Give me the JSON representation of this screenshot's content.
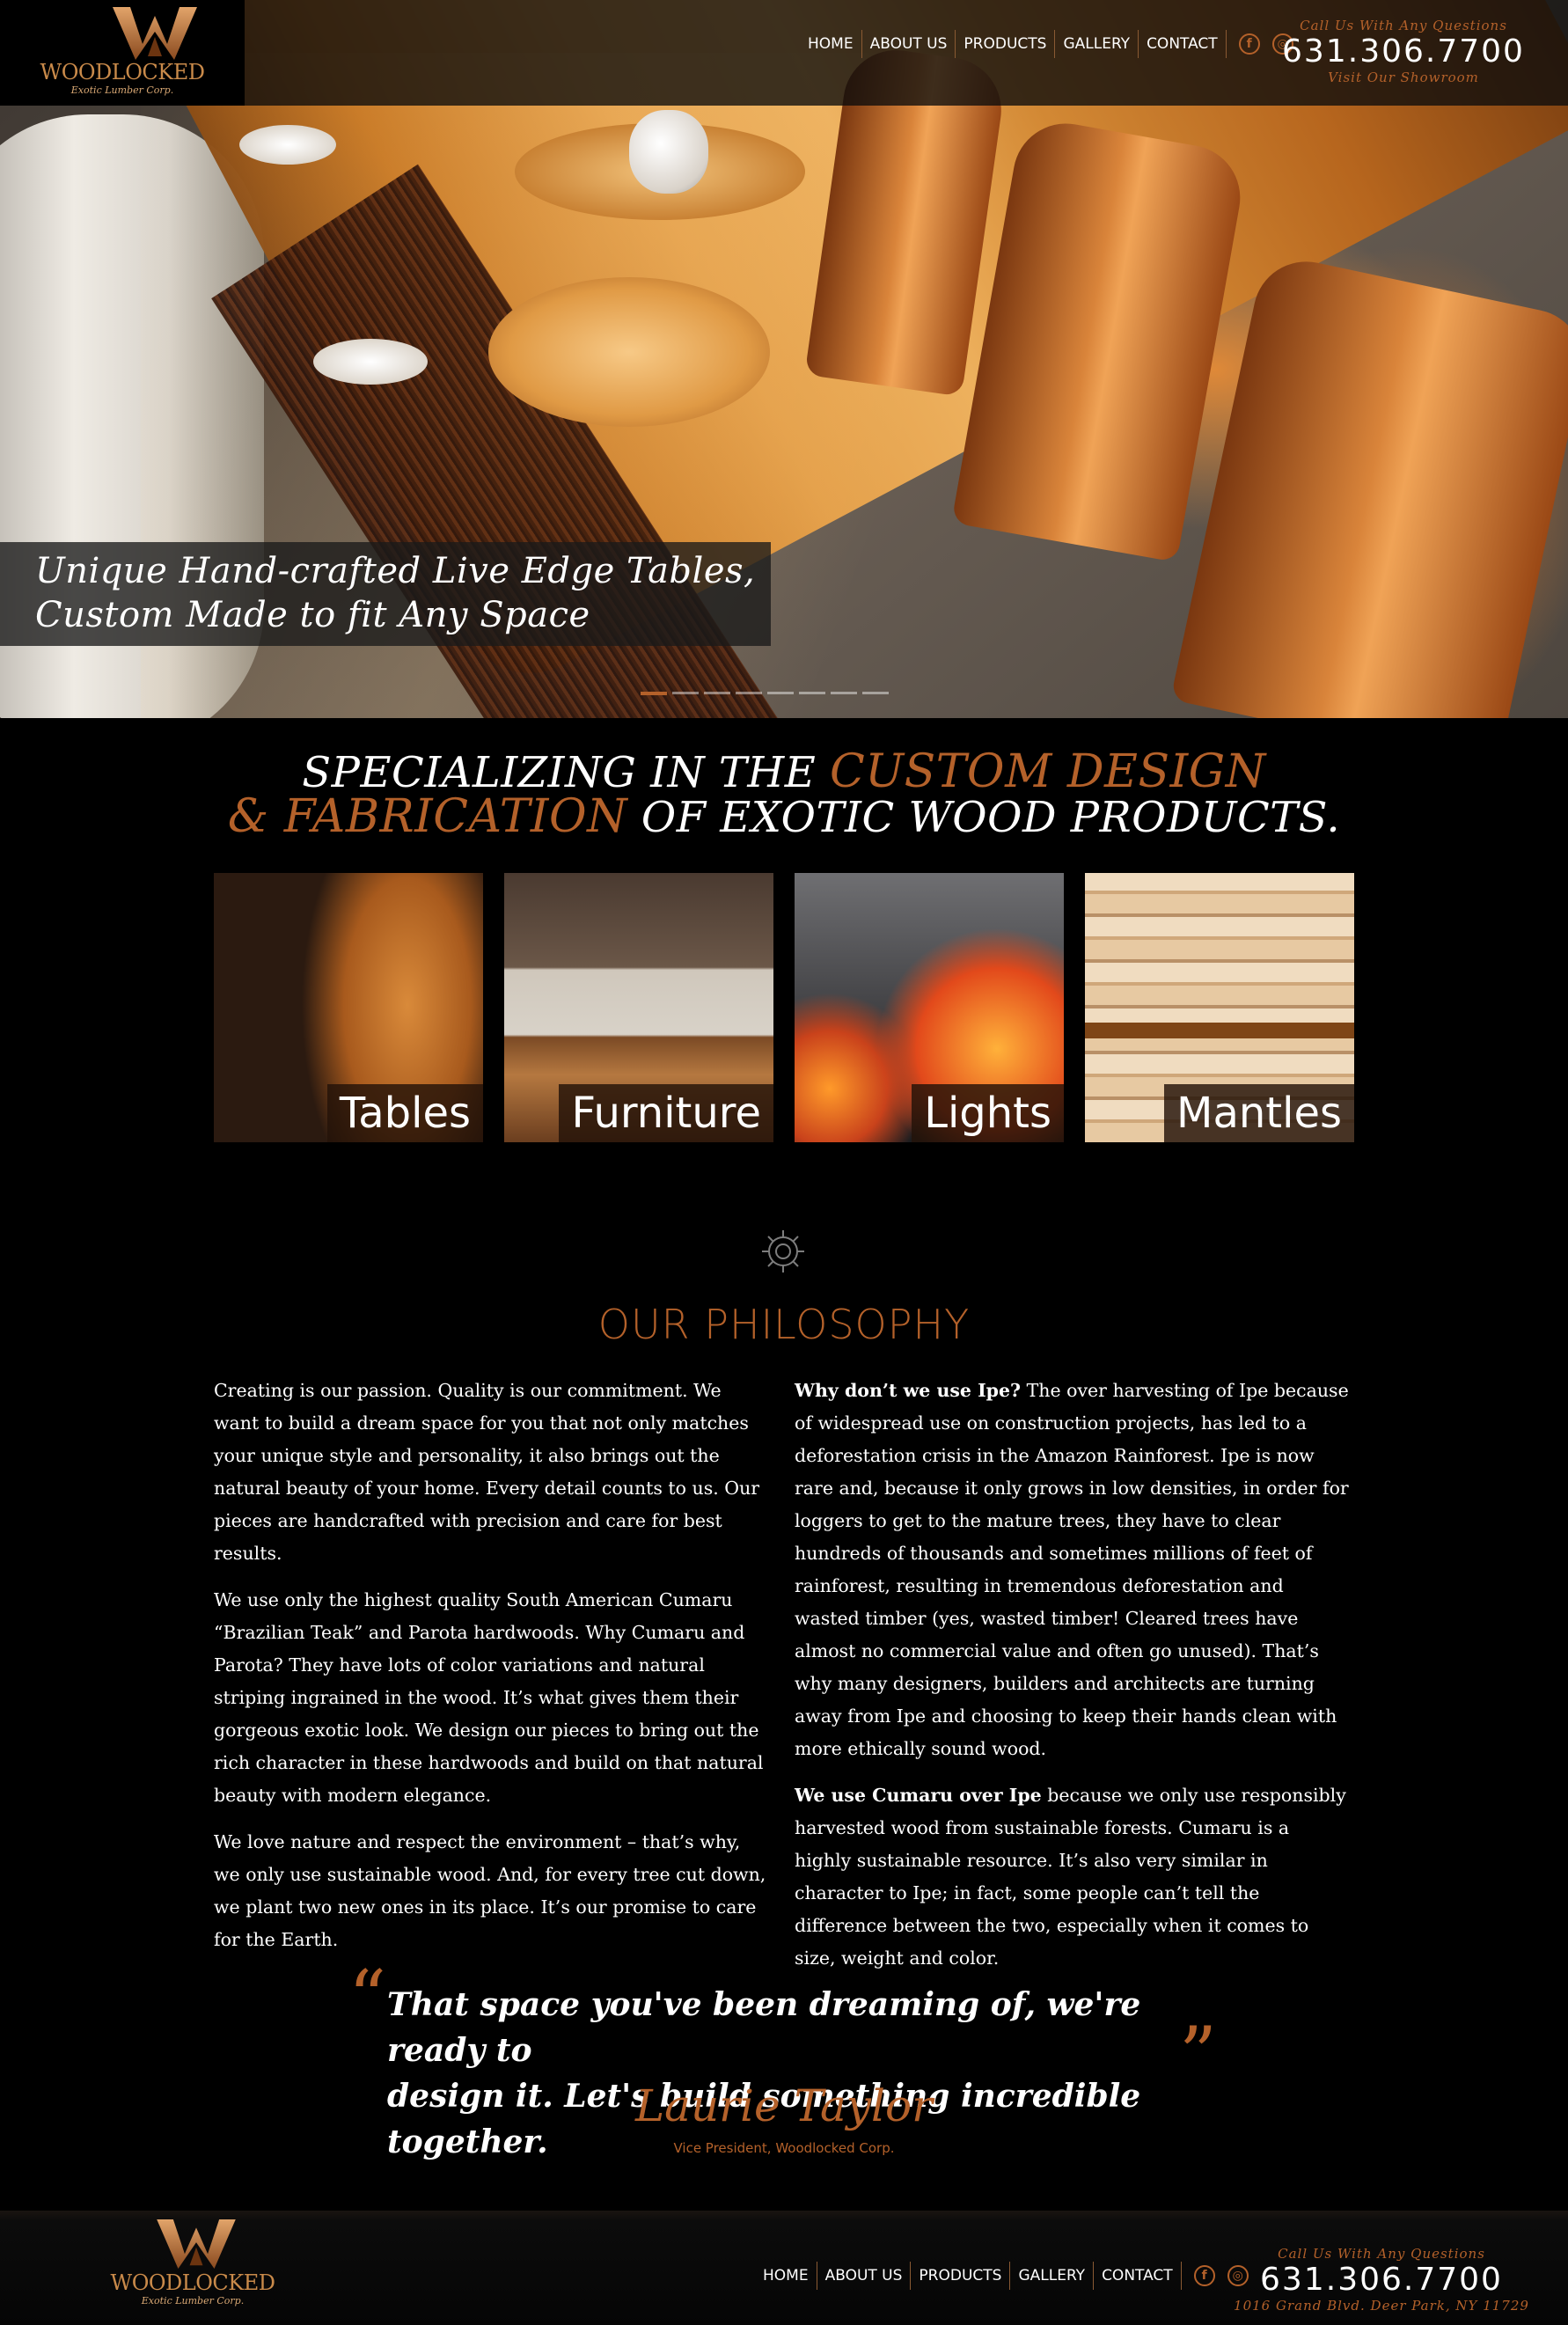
{
  "header": {
    "logo": {
      "name": "WOODLOCKED",
      "tagline": "Exotic Lumber Corp."
    },
    "nav": [
      "HOME",
      "ABOUT US",
      "PRODUCTS",
      "GALLERY",
      "CONTACT"
    ],
    "social": [
      {
        "icon": "facebook-icon",
        "glyph": "f"
      },
      {
        "icon": "instagram-icon",
        "glyph": "◎"
      }
    ],
    "contact": {
      "top": "Call Us With Any Questions",
      "phone": "631.306.7700",
      "bottom": "Visit Our Showroom"
    }
  },
  "hero": {
    "caption_line1": "Unique Hand-crafted Live Edge Tables,",
    "caption_line2": "Custom Made to fit Any Space",
    "slides_total": 8,
    "active_slide": 1
  },
  "headline": {
    "part1": "SPECIALIZING IN THE ",
    "accent1": "CUSTOM DESIGN",
    "accent2": "& FABRICATION",
    "part2": " OF EXOTIC WOOD PRODUCTS."
  },
  "categories": [
    {
      "label": "Tables"
    },
    {
      "label": "Furniture"
    },
    {
      "label": "Lights"
    },
    {
      "label": "Mantles"
    }
  ],
  "philosophy": {
    "icon": "gear-icon",
    "title": "OUR PHILOSOPHY",
    "left": [
      "Creating is our passion. Quality is our commitment. We want to build a dream space for you that not only matches your unique style and personality, it also brings out the natural beauty of your home. Every detail counts to us. Our pieces are handcrafted with precision and care for best results.",
      "We use only the highest quality South American Cumaru “Brazilian Teak” and Parota hardwoods. Why Cumaru and Parota? They have lots of color variations and natural striping ingrained in the wood. It’s what gives them their gorgeous exotic look. We design our pieces to bring out the rich character in these hardwoods and build on that natural beauty with modern elegance.",
      "We love nature and respect the environment – that’s why, we only use sustainable wood. And, for every tree cut down, we plant two new ones in its place. It’s our promise to care for the Earth."
    ],
    "right": [
      {
        "bold": "Why don’t we use Ipe?",
        "text": " The over harvesting of Ipe because of widespread use on construction projects, has led to a deforestation crisis in the Amazon Rainforest. Ipe is now rare and, because it only grows in low densities, in order for loggers to get to the mature trees, they have to clear hundreds of thousands and sometimes millions of feet of rainforest, resulting in tremendous deforestation and wasted timber (yes, wasted timber! Cleared trees have almost no commercial value and often go unused). That’s why many designers, builders and architects are turning away from Ipe and choosing to keep their hands clean with more ethically sound wood."
      },
      {
        "bold": "We use Cumaru over Ipe",
        "text": " because we only use responsibly harvested wood from sustainable forests. Cumaru is a highly sustainable resource. It’s also very similar in character to Ipe; in fact, some people can’t tell the difference between the two, especially when it comes to size, weight and color."
      }
    ]
  },
  "quote": {
    "open_mark": "“",
    "close_mark": "”",
    "line1": "That space you've been dreaming of, we're ready to",
    "line2": "design it. Let's build something incredible together.",
    "signature": "Laurie Taylor",
    "signature_title": "Vice President, Woodlocked Corp."
  },
  "footer": {
    "logo": {
      "name": "WOODLOCKED",
      "tagline": "Exotic Lumber Corp."
    },
    "nav": [
      "HOME",
      "ABOUT US",
      "PRODUCTS",
      "GALLERY",
      "CONTACT"
    ],
    "contact": {
      "top": "Call Us With Any Questions",
      "phone": "631.306.7700",
      "bottom": "1016 Grand Blvd. Deer Park, NY 11729"
    }
  },
  "colors": {
    "accent": "#b4612a",
    "background": "#000000",
    "text": "#ffffff"
  }
}
